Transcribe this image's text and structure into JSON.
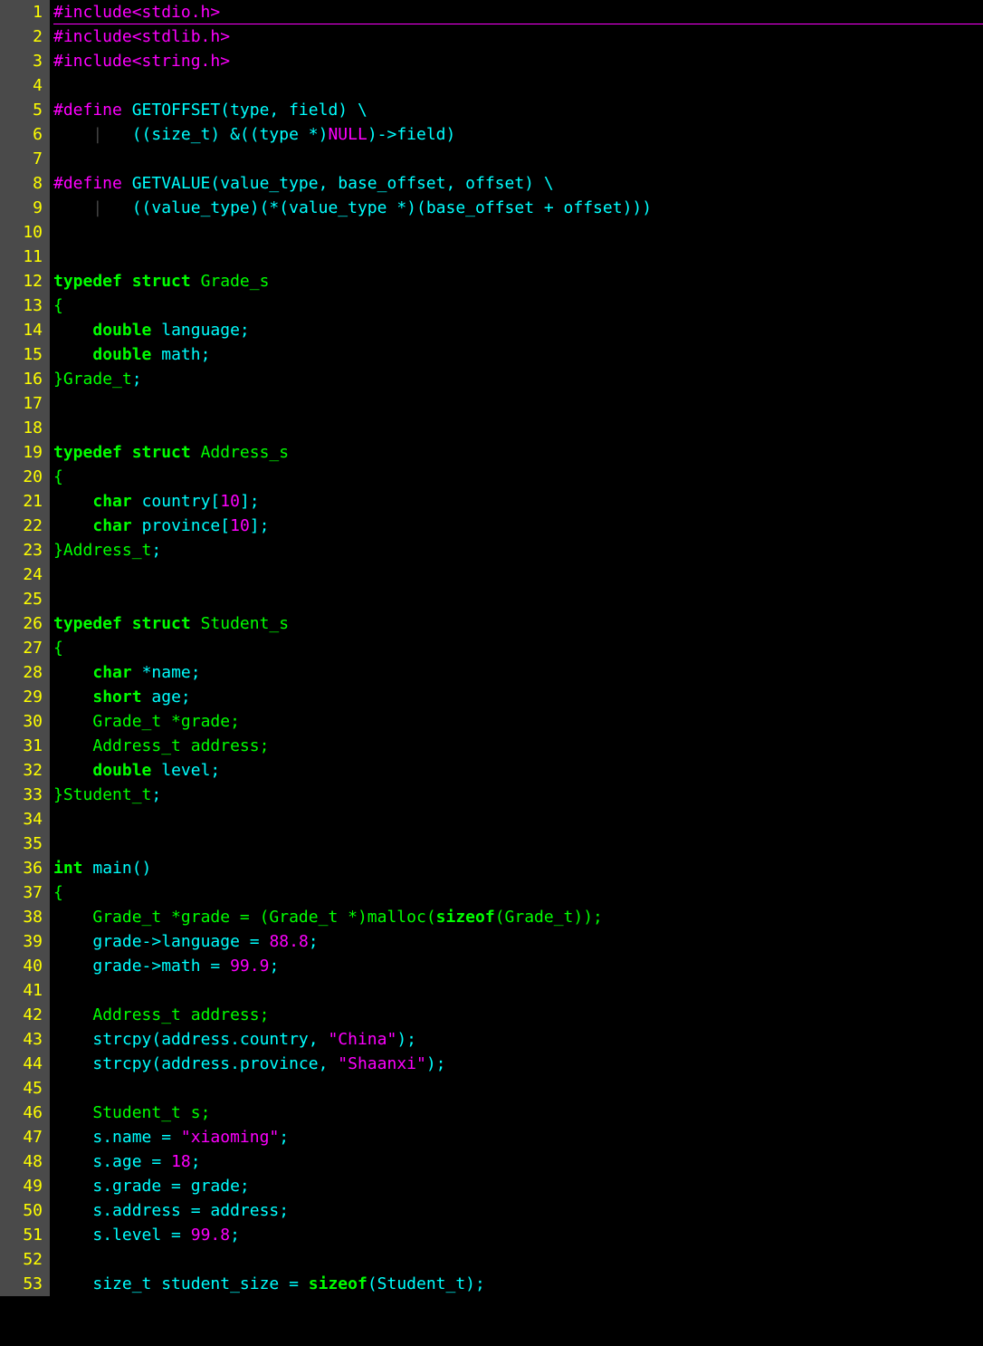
{
  "editor": {
    "language": "c",
    "lines": [
      {
        "n": 1,
        "tokens": [
          {
            "c": "tk-preproc",
            "t": "#include"
          },
          {
            "c": "tk-header",
            "t": "<stdio.h>"
          }
        ]
      },
      {
        "n": 2,
        "tokens": [
          {
            "c": "tk-preproc",
            "t": "#include"
          },
          {
            "c": "tk-header",
            "t": "<stdlib.h>"
          }
        ]
      },
      {
        "n": 3,
        "tokens": [
          {
            "c": "tk-preproc",
            "t": "#include"
          },
          {
            "c": "tk-header",
            "t": "<string.h>"
          }
        ]
      },
      {
        "n": 4,
        "tokens": []
      },
      {
        "n": 5,
        "tokens": [
          {
            "c": "tk-preproc",
            "t": "#define"
          },
          {
            "c": "tk-plain",
            "t": " "
          },
          {
            "c": "tk-macroname",
            "t": "GETOFFSET(type, field) \\"
          }
        ]
      },
      {
        "n": 6,
        "tokens": [
          {
            "c": "tk-plain",
            "t": "    "
          },
          {
            "c": "tk-indent",
            "t": "|   "
          },
          {
            "c": "tk-ident",
            "t": "((size_t) &((type *)"
          },
          {
            "c": "tk-null",
            "t": "NULL"
          },
          {
            "c": "tk-ident",
            "t": ")->field)"
          }
        ]
      },
      {
        "n": 7,
        "tokens": []
      },
      {
        "n": 8,
        "tokens": [
          {
            "c": "tk-preproc",
            "t": "#define"
          },
          {
            "c": "tk-plain",
            "t": " "
          },
          {
            "c": "tk-macroname",
            "t": "GETVALUE(value_type, base_offset, offset) \\"
          }
        ]
      },
      {
        "n": 9,
        "tokens": [
          {
            "c": "tk-plain",
            "t": "    "
          },
          {
            "c": "tk-indent",
            "t": "|   "
          },
          {
            "c": "tk-ident",
            "t": "((value_type)(*(value_type *)(base_offset + offset)))"
          }
        ]
      },
      {
        "n": 10,
        "tokens": []
      },
      {
        "n": 11,
        "tokens": []
      },
      {
        "n": 12,
        "tokens": [
          {
            "c": "tk-keyword",
            "t": "typedef"
          },
          {
            "c": "tk-plain",
            "t": " "
          },
          {
            "c": "tk-keyword",
            "t": "struct"
          },
          {
            "c": "tk-plain",
            "t": " "
          },
          {
            "c": "tk-type",
            "t": "Grade_s"
          }
        ]
      },
      {
        "n": 13,
        "tokens": [
          {
            "c": "tk-brace",
            "t": "{"
          }
        ]
      },
      {
        "n": 14,
        "tokens": [
          {
            "c": "tk-plain",
            "t": "    "
          },
          {
            "c": "tk-keyword",
            "t": "double"
          },
          {
            "c": "tk-plain",
            "t": " "
          },
          {
            "c": "tk-ident",
            "t": "language;"
          }
        ]
      },
      {
        "n": 15,
        "tokens": [
          {
            "c": "tk-plain",
            "t": "    "
          },
          {
            "c": "tk-keyword",
            "t": "double"
          },
          {
            "c": "tk-plain",
            "t": " "
          },
          {
            "c": "tk-ident",
            "t": "math;"
          }
        ]
      },
      {
        "n": 16,
        "tokens": [
          {
            "c": "tk-brace",
            "t": "}"
          },
          {
            "c": "tk-type",
            "t": "Grade_t"
          },
          {
            "c": "tk-ident",
            "t": ";"
          }
        ]
      },
      {
        "n": 17,
        "tokens": []
      },
      {
        "n": 18,
        "tokens": []
      },
      {
        "n": 19,
        "tokens": [
          {
            "c": "tk-keyword",
            "t": "typedef"
          },
          {
            "c": "tk-plain",
            "t": " "
          },
          {
            "c": "tk-keyword",
            "t": "struct"
          },
          {
            "c": "tk-plain",
            "t": " "
          },
          {
            "c": "tk-type",
            "t": "Address_s"
          }
        ]
      },
      {
        "n": 20,
        "tokens": [
          {
            "c": "tk-brace",
            "t": "{"
          }
        ]
      },
      {
        "n": 21,
        "tokens": [
          {
            "c": "tk-plain",
            "t": "    "
          },
          {
            "c": "tk-keyword",
            "t": "char"
          },
          {
            "c": "tk-plain",
            "t": " "
          },
          {
            "c": "tk-ident",
            "t": "country["
          },
          {
            "c": "tk-number",
            "t": "10"
          },
          {
            "c": "tk-ident",
            "t": "];"
          }
        ]
      },
      {
        "n": 22,
        "tokens": [
          {
            "c": "tk-plain",
            "t": "    "
          },
          {
            "c": "tk-keyword",
            "t": "char"
          },
          {
            "c": "tk-plain",
            "t": " "
          },
          {
            "c": "tk-ident",
            "t": "province["
          },
          {
            "c": "tk-number",
            "t": "10"
          },
          {
            "c": "tk-ident",
            "t": "];"
          }
        ]
      },
      {
        "n": 23,
        "tokens": [
          {
            "c": "tk-brace",
            "t": "}"
          },
          {
            "c": "tk-type",
            "t": "Address_t"
          },
          {
            "c": "tk-ident",
            "t": ";"
          }
        ]
      },
      {
        "n": 24,
        "tokens": []
      },
      {
        "n": 25,
        "tokens": []
      },
      {
        "n": 26,
        "tokens": [
          {
            "c": "tk-keyword",
            "t": "typedef"
          },
          {
            "c": "tk-plain",
            "t": " "
          },
          {
            "c": "tk-keyword",
            "t": "struct"
          },
          {
            "c": "tk-plain",
            "t": " "
          },
          {
            "c": "tk-type",
            "t": "Student_s"
          }
        ]
      },
      {
        "n": 27,
        "tokens": [
          {
            "c": "tk-brace",
            "t": "{"
          }
        ]
      },
      {
        "n": 28,
        "tokens": [
          {
            "c": "tk-plain",
            "t": "    "
          },
          {
            "c": "tk-keyword",
            "t": "char"
          },
          {
            "c": "tk-plain",
            "t": " "
          },
          {
            "c": "tk-ident",
            "t": "*name;"
          }
        ]
      },
      {
        "n": 29,
        "tokens": [
          {
            "c": "tk-plain",
            "t": "    "
          },
          {
            "c": "tk-keyword",
            "t": "short"
          },
          {
            "c": "tk-plain",
            "t": " "
          },
          {
            "c": "tk-ident",
            "t": "age;"
          }
        ]
      },
      {
        "n": 30,
        "tokens": [
          {
            "c": "tk-plain",
            "t": "    "
          },
          {
            "c": "tk-type",
            "t": "Grade_t *grade;"
          }
        ]
      },
      {
        "n": 31,
        "tokens": [
          {
            "c": "tk-plain",
            "t": "    "
          },
          {
            "c": "tk-type",
            "t": "Address_t address;"
          }
        ]
      },
      {
        "n": 32,
        "tokens": [
          {
            "c": "tk-plain",
            "t": "    "
          },
          {
            "c": "tk-keyword",
            "t": "double"
          },
          {
            "c": "tk-plain",
            "t": " "
          },
          {
            "c": "tk-ident",
            "t": "level;"
          }
        ]
      },
      {
        "n": 33,
        "tokens": [
          {
            "c": "tk-brace",
            "t": "}"
          },
          {
            "c": "tk-type",
            "t": "Student_t"
          },
          {
            "c": "tk-ident",
            "t": ";"
          }
        ]
      },
      {
        "n": 34,
        "tokens": []
      },
      {
        "n": 35,
        "tokens": []
      },
      {
        "n": 36,
        "tokens": [
          {
            "c": "tk-keyword",
            "t": "int"
          },
          {
            "c": "tk-plain",
            "t": " "
          },
          {
            "c": "tk-ident",
            "t": "main()"
          }
        ]
      },
      {
        "n": 37,
        "tokens": [
          {
            "c": "tk-brace",
            "t": "{"
          }
        ]
      },
      {
        "n": 38,
        "tokens": [
          {
            "c": "tk-plain",
            "t": "    "
          },
          {
            "c": "tk-type",
            "t": "Grade_t *grade = (Grade_t *)malloc("
          },
          {
            "c": "tk-keyword",
            "t": "sizeof"
          },
          {
            "c": "tk-type",
            "t": "(Grade_t));"
          }
        ]
      },
      {
        "n": 39,
        "tokens": [
          {
            "c": "tk-plain",
            "t": "    "
          },
          {
            "c": "tk-ident",
            "t": "grade->language = "
          },
          {
            "c": "tk-number",
            "t": "88.8"
          },
          {
            "c": "tk-ident",
            "t": ";"
          }
        ]
      },
      {
        "n": 40,
        "tokens": [
          {
            "c": "tk-plain",
            "t": "    "
          },
          {
            "c": "tk-ident",
            "t": "grade->math = "
          },
          {
            "c": "tk-number",
            "t": "99.9"
          },
          {
            "c": "tk-ident",
            "t": ";"
          }
        ]
      },
      {
        "n": 41,
        "tokens": []
      },
      {
        "n": 42,
        "tokens": [
          {
            "c": "tk-plain",
            "t": "    "
          },
          {
            "c": "tk-type",
            "t": "Address_t address;"
          }
        ]
      },
      {
        "n": 43,
        "tokens": [
          {
            "c": "tk-plain",
            "t": "    "
          },
          {
            "c": "tk-ident",
            "t": "strcpy(address.country, "
          },
          {
            "c": "tk-string",
            "t": "\"China\""
          },
          {
            "c": "tk-ident",
            "t": ");"
          }
        ]
      },
      {
        "n": 44,
        "tokens": [
          {
            "c": "tk-plain",
            "t": "    "
          },
          {
            "c": "tk-ident",
            "t": "strcpy(address.province, "
          },
          {
            "c": "tk-string",
            "t": "\"Shaanxi\""
          },
          {
            "c": "tk-ident",
            "t": ");"
          }
        ]
      },
      {
        "n": 45,
        "tokens": []
      },
      {
        "n": 46,
        "tokens": [
          {
            "c": "tk-plain",
            "t": "    "
          },
          {
            "c": "tk-type",
            "t": "Student_t s;"
          }
        ]
      },
      {
        "n": 47,
        "tokens": [
          {
            "c": "tk-plain",
            "t": "    "
          },
          {
            "c": "tk-ident",
            "t": "s.name = "
          },
          {
            "c": "tk-string",
            "t": "\"xiaoming\""
          },
          {
            "c": "tk-ident",
            "t": ";"
          }
        ]
      },
      {
        "n": 48,
        "tokens": [
          {
            "c": "tk-plain",
            "t": "    "
          },
          {
            "c": "tk-ident",
            "t": "s.age = "
          },
          {
            "c": "tk-number",
            "t": "18"
          },
          {
            "c": "tk-ident",
            "t": ";"
          }
        ]
      },
      {
        "n": 49,
        "tokens": [
          {
            "c": "tk-plain",
            "t": "    "
          },
          {
            "c": "tk-ident",
            "t": "s.grade = grade;"
          }
        ]
      },
      {
        "n": 50,
        "tokens": [
          {
            "c": "tk-plain",
            "t": "    "
          },
          {
            "c": "tk-ident",
            "t": "s.address = address;"
          }
        ]
      },
      {
        "n": 51,
        "tokens": [
          {
            "c": "tk-plain",
            "t": "    "
          },
          {
            "c": "tk-ident",
            "t": "s.level = "
          },
          {
            "c": "tk-number",
            "t": "99.8"
          },
          {
            "c": "tk-ident",
            "t": ";"
          }
        ]
      },
      {
        "n": 52,
        "tokens": []
      },
      {
        "n": 53,
        "tokens": [
          {
            "c": "tk-plain",
            "t": "    "
          },
          {
            "c": "tk-ident",
            "t": "size_t student_size = "
          },
          {
            "c": "tk-keyword",
            "t": "sizeof"
          },
          {
            "c": "tk-ident",
            "t": "(Student_t);"
          }
        ]
      }
    ]
  }
}
